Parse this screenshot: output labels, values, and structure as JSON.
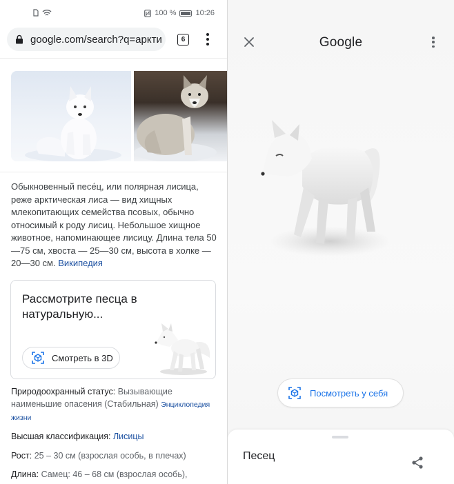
{
  "status_bar": {
    "battery_percent": "100 %",
    "time": "10:26",
    "icons": [
      "sim-icon",
      "wifi-icon",
      "nfc-icon",
      "battery-icon"
    ]
  },
  "browser": {
    "url": "google.com/search?q=арктический песец",
    "tab_count": "6"
  },
  "description": {
    "text": "Обыкновенный песе́ц, или полярная лисица, реже арктическая лиса — вид хищных млекопитающих семейства псовых, обычно относимый к роду лисиц. Небольшое хищное животное, напоминающее лисицу. Длина тела 50—75 см, хвоста — 25—30 см, высота в холке — 20—30 см.",
    "source_link": "Википедия"
  },
  "view_3d_card": {
    "title": "Рассмотрите песца в натуральную...",
    "button_label": "Смотреть в 3D"
  },
  "facts": {
    "conservation": {
      "label": "Природоохранный статус:",
      "value": "Вызывающие наименьшие опасения (Стабильная)",
      "source_part1": "Энциклопедия",
      "source_part2": "жизни"
    },
    "classification": {
      "label": "Высшая классификация:",
      "value": "Лисицы"
    },
    "height": {
      "label": "Рост:",
      "value": "25 – 30 см (взрослая особь, в плечах)"
    },
    "length": {
      "label": "Длина:",
      "value": "Самец: 46 – 68 см (взрослая особь),"
    }
  },
  "viewer": {
    "title": "Google",
    "ar_button_label": "Посмотреть у себя",
    "sheet_title": "Песец"
  },
  "colors": {
    "link": "#1a4fa0",
    "accent": "#1a73e8",
    "viewer_bg": "#f6f6f6"
  }
}
